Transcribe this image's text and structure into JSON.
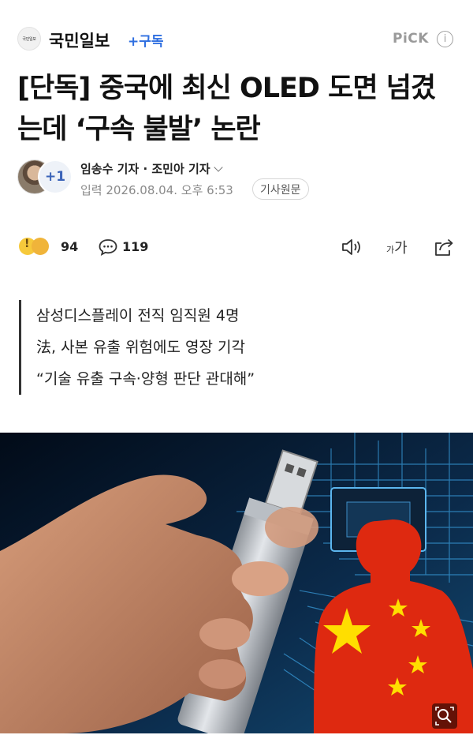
{
  "header": {
    "logo_text": "국민일보",
    "press_name": "국민일보",
    "subscribe_label": "+구독",
    "pick_label": "PiCK",
    "info_icon": "info-icon"
  },
  "article": {
    "headline_line1": "[단독] 중국에 최신 OLED 도면 넘겼",
    "headline_line2": "는데 ‘구속 불발’ 논란",
    "reporters": "임송수 기자 · 조민아 기자",
    "extra_reporters": "+1",
    "dateline": "입력 2026.08.04. 오후 6:53",
    "source_button": "기사원문",
    "summary": [
      "삼성디스플레이 전직 임직원 4명",
      "法, 사본 유출 위험에도 영장 기각",
      "“기술 유출 구속·양형 판단 관대해”"
    ]
  },
  "toolbar": {
    "reaction_count": "94",
    "comment_count": "119",
    "font_small": "가",
    "font_big": "가"
  },
  "colors": {
    "accent": "#2f6fe0",
    "flag_red": "#de2910",
    "flag_yellow": "#ffde00"
  }
}
